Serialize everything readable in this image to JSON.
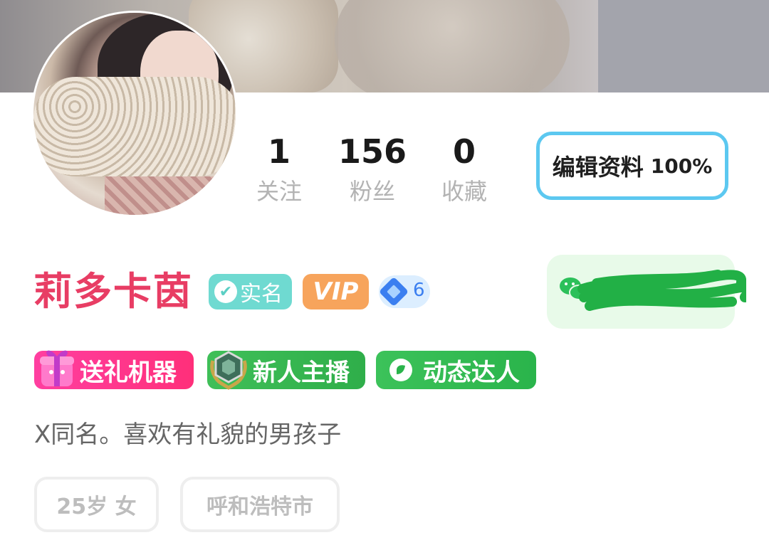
{
  "profile": {
    "name": "莉多卡茵",
    "bio": "X同名。喜欢有礼貌的男孩子"
  },
  "stats": [
    {
      "value": "1",
      "label": "关注"
    },
    {
      "value": "156",
      "label": "粉丝"
    },
    {
      "value": "0",
      "label": "收藏"
    }
  ],
  "edit_button": {
    "label": "编辑资料",
    "completion": "100%"
  },
  "badges": {
    "verified": "实名",
    "vip": "VIP",
    "level": "6"
  },
  "tags": [
    {
      "label": "送礼机器",
      "icon": "gift-icon"
    },
    {
      "label": "新人主播",
      "icon": "medal-icon"
    },
    {
      "label": "动态达人",
      "icon": "activity-icon"
    }
  ],
  "info_chips": {
    "age_gender": "25岁 女",
    "city": "呼和浩特市"
  },
  "wechat": {
    "icon": "wechat-icon"
  },
  "colors": {
    "name": "#e83d64",
    "edit_border": "#5cc8f0",
    "verified_bg": "#6fdad1",
    "vip_bg": "#f7a45c",
    "gift_tag": "#ff2f7a",
    "green_tag": "#2fae4a",
    "wechat_bg": "#e8fae9"
  }
}
